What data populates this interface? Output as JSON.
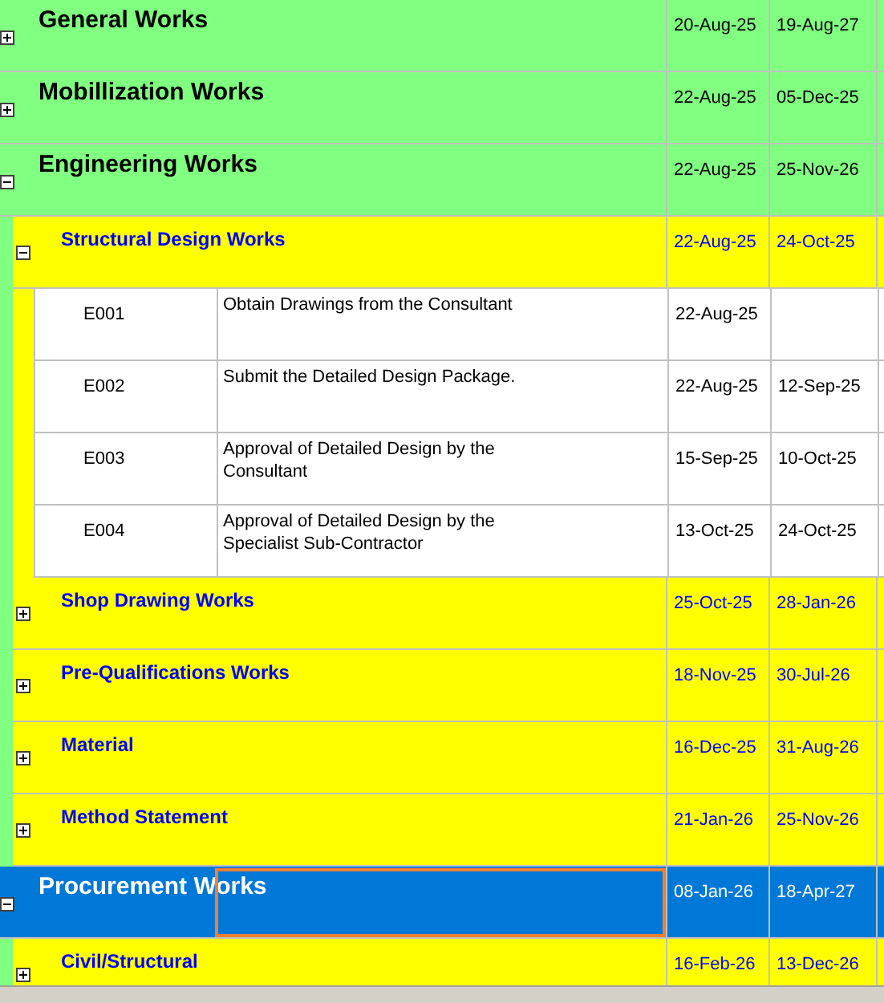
{
  "rows": [
    {
      "kind": "group",
      "name": "General Works",
      "start": "20-Aug-25",
      "finish": "19-Aug-27",
      "expanded": false,
      "selected": false
    },
    {
      "kind": "group",
      "name": "Mobillization Works",
      "start": "22-Aug-25",
      "finish": "05-Dec-25",
      "expanded": false,
      "selected": false
    },
    {
      "kind": "group",
      "name": "Engineering Works",
      "start": "22-Aug-25",
      "finish": "25-Nov-26",
      "expanded": true,
      "selected": false,
      "children": [
        {
          "kind": "group",
          "name": "Structural Design Works",
          "start": "22-Aug-25",
          "finish": "24-Oct-25",
          "expanded": true,
          "selected": false,
          "children": [
            {
              "kind": "task",
              "id": "E001",
              "name": "Obtain Drawings from the Consultant",
              "start": "22-Aug-25"
            },
            {
              "kind": "task",
              "id": "E002",
              "name": "Submit the Detailed Design Package.",
              "start": "22-Aug-25",
              "finish": "12-Sep-25"
            },
            {
              "kind": "task",
              "id": "E003",
              "name": "Approval of Detailed Design by the Consultant",
              "start": "15-Sep-25",
              "finish": "10-Oct-25"
            },
            {
              "kind": "task",
              "id": "E004",
              "name": "Approval of Detailed Design by the Specialist Sub-Contractor",
              "start": "13-Oct-25",
              "finish": "24-Oct-25"
            }
          ]
        },
        {
          "kind": "group",
          "name": "Shop Drawing Works",
          "start": "25-Oct-25",
          "finish": "28-Jan-26",
          "expanded": false,
          "selected": false
        },
        {
          "kind": "group",
          "name": "Pre-Qualifications Works",
          "start": "18-Nov-25",
          "finish": "30-Jul-26",
          "expanded": false,
          "selected": false
        },
        {
          "kind": "group",
          "name": "Material",
          "start": "16-Dec-25",
          "finish": "31-Aug-26",
          "expanded": false,
          "selected": false
        },
        {
          "kind": "group",
          "name": "Method Statement",
          "start": "21-Jan-26",
          "finish": "25-Nov-26",
          "expanded": false,
          "selected": false
        }
      ]
    },
    {
      "kind": "group",
      "name": "Procurement Works",
      "start": "08-Jan-26",
      "finish": "18-Apr-27",
      "expanded": true,
      "selected": true,
      "children": [
        {
          "kind": "group",
          "name": "Civil/Structural",
          "start": "16-Feb-26",
          "finish": "13-Dec-26",
          "expanded": false,
          "selected": false
        }
      ]
    }
  ]
}
